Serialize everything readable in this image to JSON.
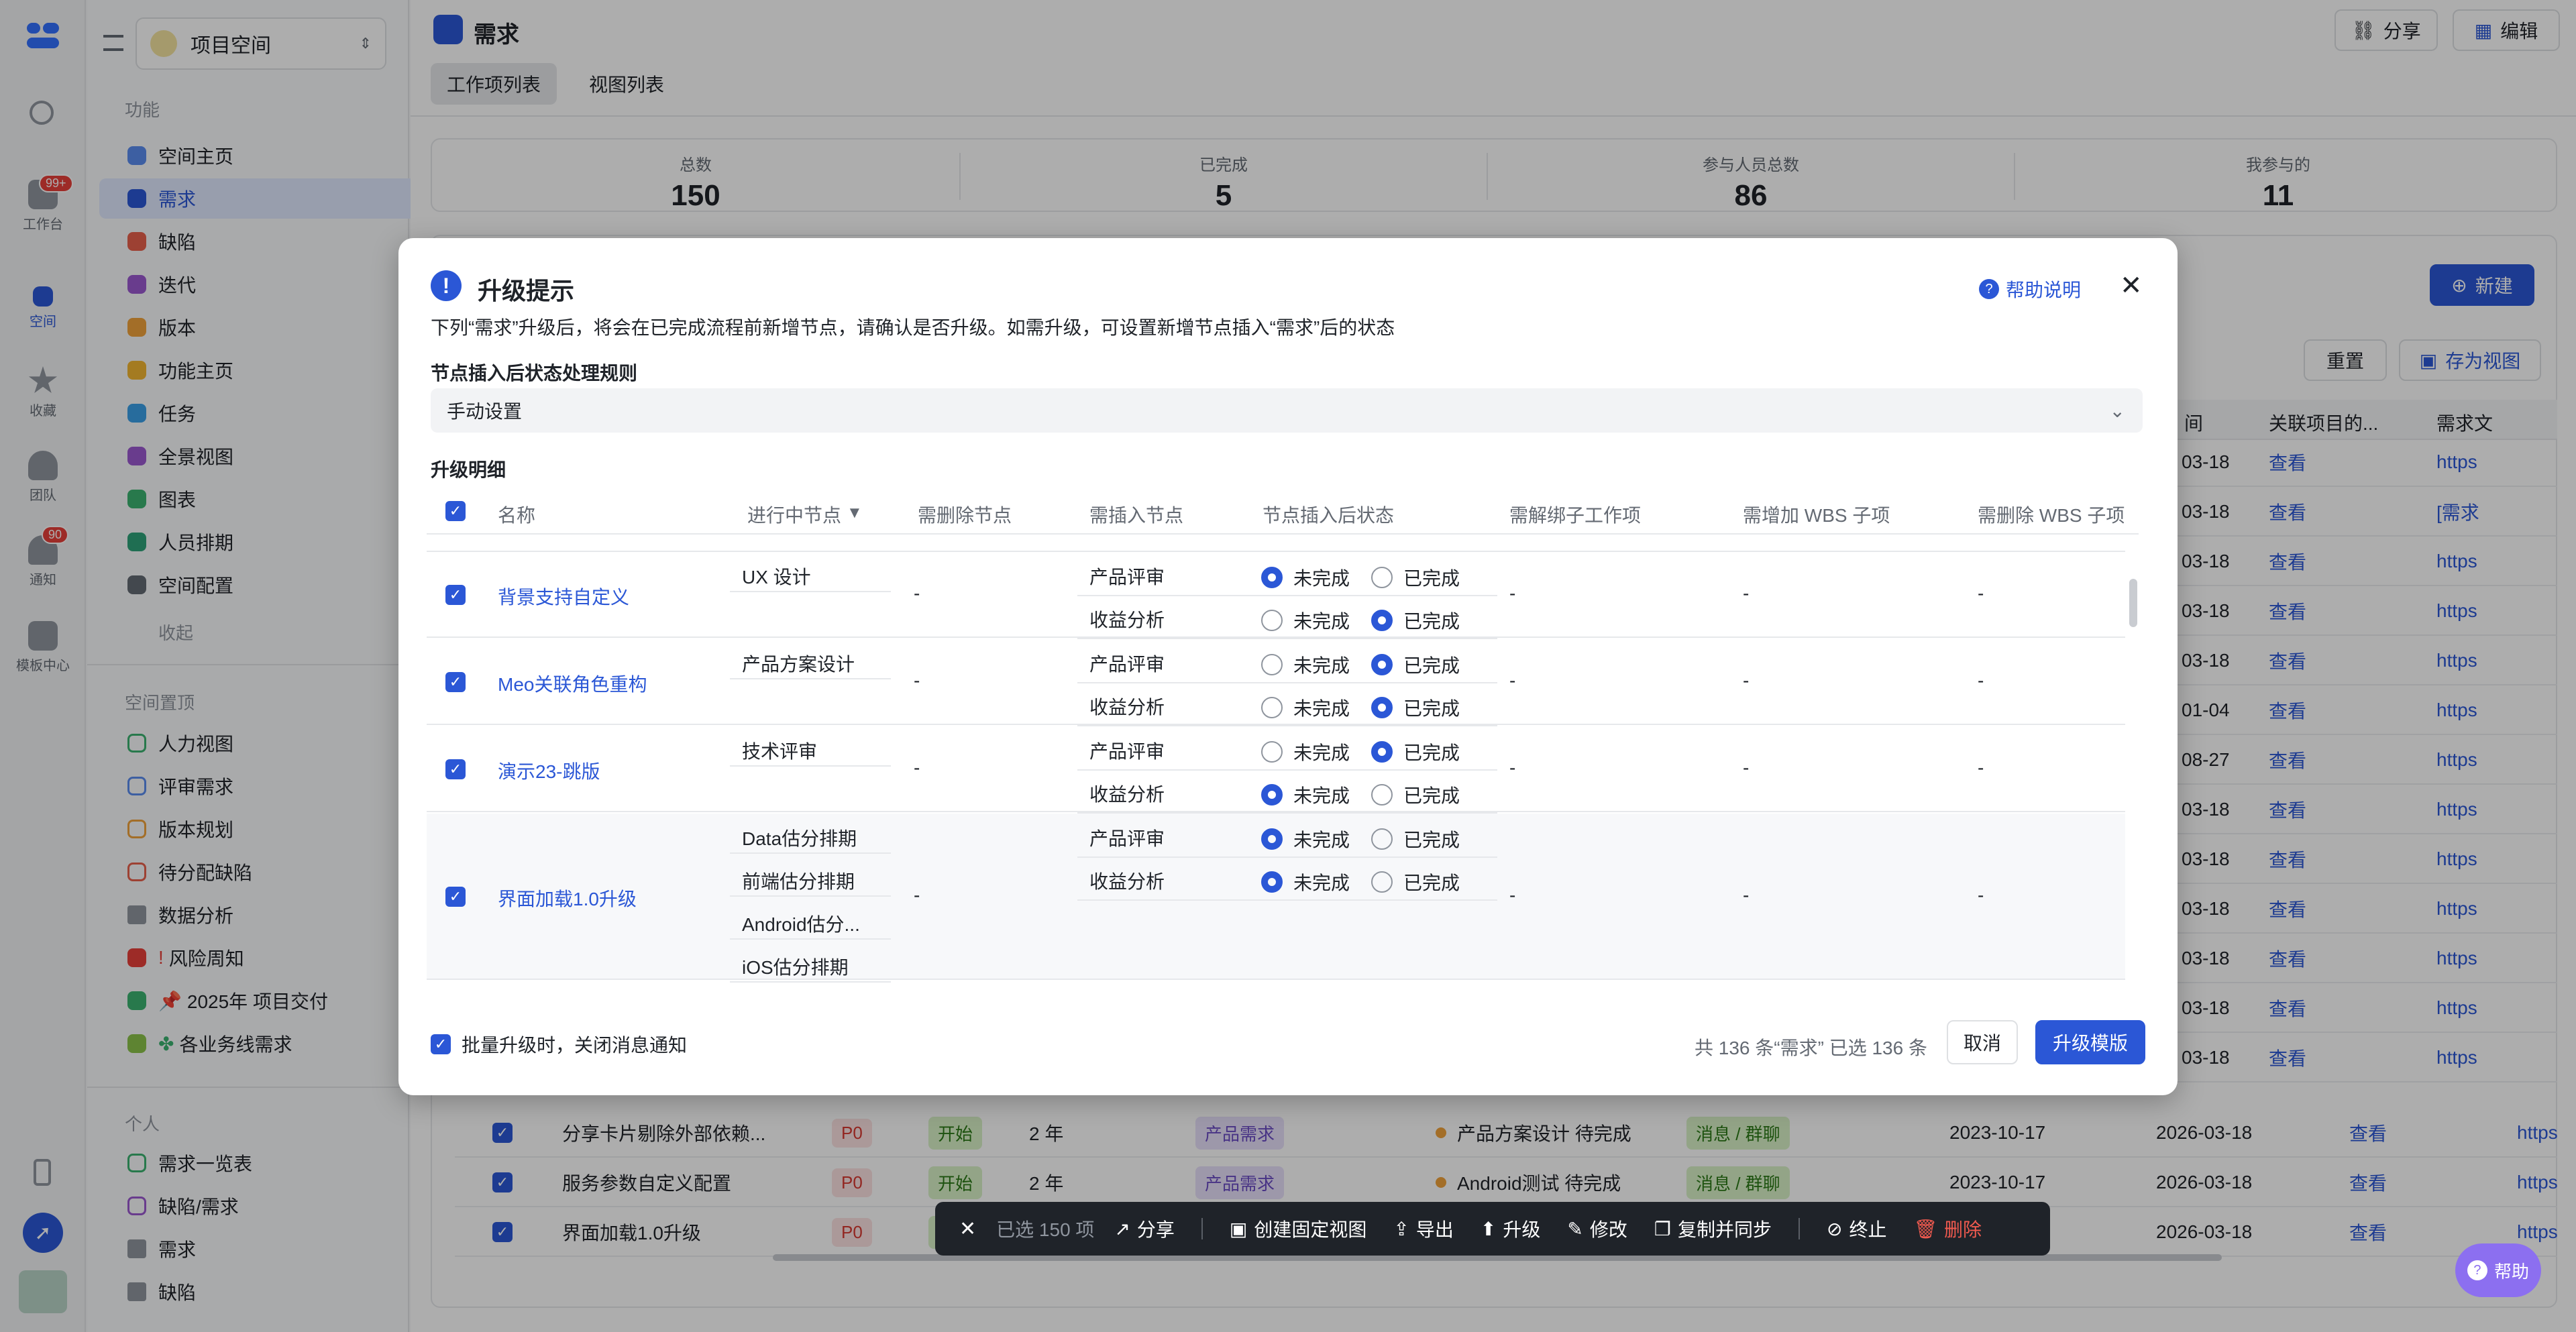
{
  "rail": {
    "items": [
      {
        "label": "工作台",
        "badge": "99+"
      },
      {
        "label": "空间"
      },
      {
        "label": "收藏"
      },
      {
        "label": "团队"
      },
      {
        "label": "通知",
        "badge": "90"
      },
      {
        "label": "模板中心"
      }
    ]
  },
  "sidebar": {
    "space_name": "项目空间",
    "sections": {
      "features": "功能",
      "pinned": "空间置顶",
      "personal": "个人"
    },
    "features": [
      "空间主页",
      "需求",
      "缺陷",
      "迭代",
      "版本",
      "功能主页",
      "任务",
      "全景视图",
      "图表",
      "人员排期",
      "空间配置"
    ],
    "collapse": "收起",
    "pinned": [
      "人力视图",
      "评审需求",
      "版本规划",
      "待分配缺陷",
      "数据分析",
      "风险周知",
      "2025年 项目交付",
      "各业务线需求"
    ],
    "personal": [
      "需求一览表",
      "缺陷/需求",
      "需求",
      "缺陷"
    ]
  },
  "header": {
    "title": "需求",
    "tabs": [
      "工作项列表",
      "视图列表"
    ],
    "share": "分享",
    "edit": "编辑"
  },
  "stats": [
    {
      "label": "总数",
      "value": "150"
    },
    {
      "label": "已完成",
      "value": "5"
    },
    {
      "label": "参与人员总数",
      "value": "86"
    },
    {
      "label": "我参与的",
      "value": "11"
    }
  ],
  "list_actions": {
    "new": "新建",
    "reset": "重置",
    "save_view": "存为视图"
  },
  "bg_table": {
    "headers": [
      "间",
      "关联项目的...",
      "需求文"
    ],
    "right_rows": [
      {
        "date": "03-18"
      },
      {
        "date": "03-18"
      },
      {
        "date": "03-18"
      },
      {
        "date": "03-18"
      },
      {
        "date": "03-18"
      },
      {
        "date": "01-04"
      },
      {
        "date": "08-27"
      },
      {
        "date": "03-18"
      },
      {
        "date": "03-18"
      },
      {
        "date": "03-18"
      },
      {
        "date": "03-18"
      },
      {
        "date": "03-18"
      },
      {
        "date": "03-18"
      }
    ],
    "view_text": "查看",
    "link_text": "https",
    "link_text_2": "[需求",
    "bottom_rows": [
      {
        "name": "分享卡片剔除外部依赖...",
        "priority": "P0",
        "status": "开始",
        "age": "2 年",
        "type": "产品需求",
        "node": "产品方案设计 待完成",
        "channel": "消息 / 群聊",
        "start": "2023-10-17",
        "end": "2026-03-18"
      },
      {
        "name": "服务参数自定义配置",
        "priority": "P0",
        "status": "开始",
        "age": "2 年",
        "type": "产品需求",
        "node": "Android测试 待完成",
        "channel": "消息 / 群聊",
        "start": "2023-10-17",
        "end": "2026-03-18"
      },
      {
        "name": "界面加载1.0升级",
        "priority": "P0",
        "status": "开",
        "age": "",
        "type": "",
        "node": "",
        "channel": "",
        "start": "2023-10-17",
        "end": "2026-03-18"
      }
    ]
  },
  "modal": {
    "title": "升级提示",
    "help": "帮助说明",
    "desc": "下列“需求”升级后，将会在已完成流程前新增节点，请确认是否升级。如需升级，可设置新增节点插入“需求”后的状态",
    "rule_label": "节点插入后状态处理规则",
    "rule_value": "手动设置",
    "detail_label": "升级明细",
    "columns": [
      "名称",
      "进行中节点",
      "需删除节点",
      "需插入节点",
      "节点插入后状态",
      "需解绑子工作项",
      "需增加 WBS 子项",
      "需删除 WBS 子项"
    ],
    "opt_incomplete": "未完成",
    "opt_complete": "已完成",
    "dash": "-",
    "rows": [
      {
        "name": "背景支持自定义",
        "nodes": [
          "UX 设计"
        ],
        "inserts": [
          {
            "node": "产品评审",
            "done": false
          },
          {
            "node": "收益分析",
            "done": true
          }
        ]
      },
      {
        "name": "Meo关联角色重构",
        "nodes": [
          "产品方案设计"
        ],
        "inserts": [
          {
            "node": "产品评审",
            "done": true
          },
          {
            "node": "收益分析",
            "done": true
          }
        ]
      },
      {
        "name": "演示23-跳版",
        "nodes": [
          "技术评审"
        ],
        "inserts": [
          {
            "node": "产品评审",
            "done": true
          },
          {
            "node": "收益分析",
            "done": false
          }
        ]
      },
      {
        "name": "界面加载1.0升级",
        "nodes": [
          "Data估分排期",
          "前端估分排期",
          "Android估分...",
          "iOS估分排期"
        ],
        "inserts": [
          {
            "node": "产品评审",
            "done": false
          },
          {
            "node": "收益分析",
            "done": false
          }
        ]
      }
    ],
    "mute_label": "批量升级时，关闭消息通知",
    "summary": "共 136 条“需求” 已选 136 条",
    "cancel": "取消",
    "confirm": "升级模版"
  },
  "toolbar": {
    "selected": "已选 150 项",
    "items": [
      "分享",
      "创建固定视图",
      "导出",
      "升级",
      "修改",
      "复制并同步",
      "终止",
      "删除"
    ]
  },
  "help_fab": "帮助"
}
